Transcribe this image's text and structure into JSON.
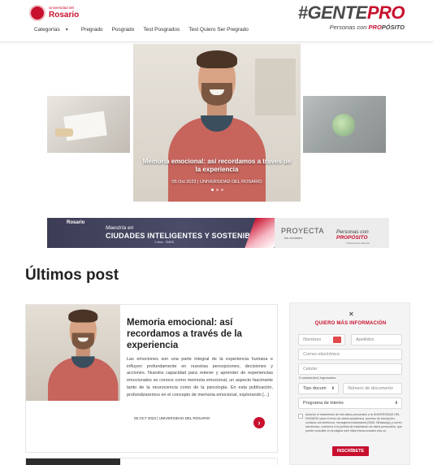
{
  "header": {
    "logo_small": "Universidad del",
    "logo_big": "Rosario",
    "brand_gente": "#GENTE",
    "brand_pro": "PRO",
    "brand_sub_prefix": "Personas con ",
    "brand_sub_pro": "PRO",
    "brand_sub_suffix": "PÓSITO",
    "nav": {
      "categorias": "Categorías",
      "items": [
        "Pregrado",
        "Posgrado",
        "Test Posgrados",
        "Test Quiero Ser Pregrado"
      ]
    }
  },
  "carousel": {
    "title": "Memoria emocional: así recordamos a través de la experiencia",
    "meta": "05 Oct 2023 | UNIVERSIDAD DEL ROSARIO",
    "dot_count": 3,
    "active_dot": 0
  },
  "banner": {
    "logo": "Rosario",
    "line1": "Maestría en",
    "line2": "CIUDADES INTELIGENTES Y SOSTENIBLES",
    "line3": "2 años · SNIES",
    "proyecta": "PROYECTA",
    "proyecta_sub": "las ciudades",
    "gente_prefix": "Personas con ",
    "gente_pro": "PROPÓSITO",
    "note": "Inscripciones abiertas"
  },
  "section": {
    "title": "Últimos post"
  },
  "post": {
    "title": "Memoria emocional: así recordamos a través de la experiencia",
    "excerpt": "Las emociones son una parte integral de la experiencia humana e influyen profundamente en nuestras percepciones, decisiones y acciones. Nuestra capacidad para retener y aprender de experiencias emocionales se conoce como memoria emocional, un aspecto fascinante tanto de la neurociencia como de la psicología. En esta publicación, profundizaremos en el concepto de memoria emocional, explorando [...]",
    "meta": "05 OCT 2023 | UNIVERSIDAD DEL ROSARIO",
    "button_icon": "chevron-right-icon"
  },
  "form": {
    "close_icon": "close-icon",
    "title": "QUIERO MÁS INFORMACIÓN",
    "nombres_placeholder": "Nombres",
    "apellidos_placeholder": "Apellidos",
    "correo_placeholder": "Correo electrónico",
    "celular_placeholder": "Celular",
    "char_count": "0 caracter(es) ingresados",
    "tipo_doc": "Tipo docum",
    "numero_placeholder": "Número de documento",
    "programa": "Programa de interés",
    "consent": "Autorizo el tratamiento de mis datos personales a la UNIVERSIDAD DEL ROSARIO para el envío de oferta académica, proceso de inscripción, contacto vía telefónica, mensajería instantánea (SMS, WhatsApp) y correo electrónico, conforme a la política de tratamiento de datos personales, que puede consultar en la página web https://www.urosario.edu.co.",
    "submit": "INSCRÍBETE"
  },
  "colors": {
    "brand_red": "#c8102e",
    "text_dark": "#222222",
    "form_bg": "#f4f4f4"
  }
}
